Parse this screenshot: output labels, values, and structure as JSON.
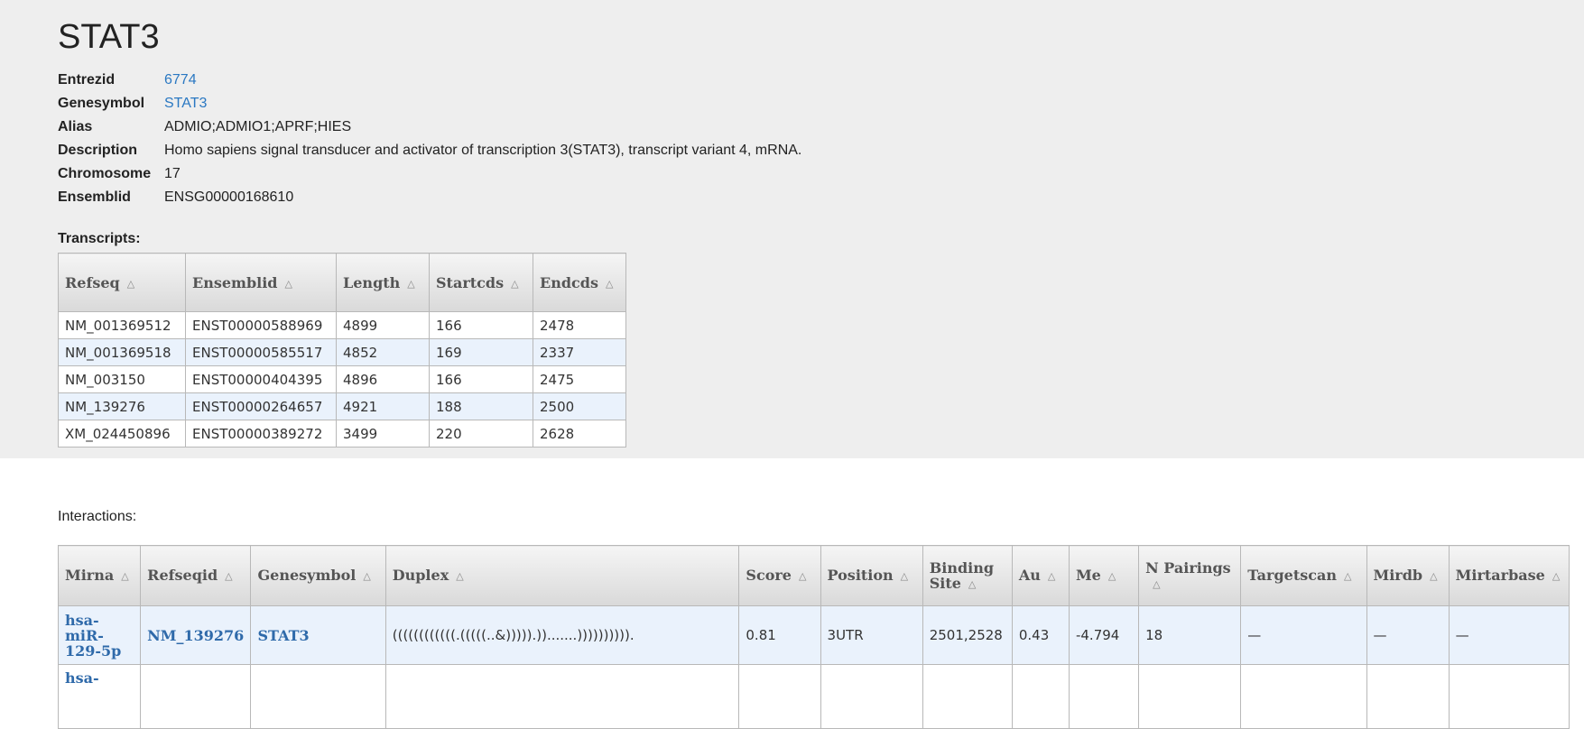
{
  "gene": {
    "title": "STAT3",
    "fields": [
      {
        "label": "Entrezid",
        "value": "6774",
        "link": true
      },
      {
        "label": "Genesymbol",
        "value": "STAT3",
        "link": true
      },
      {
        "label": "Alias",
        "value": "ADMIO;ADMIO1;APRF;HIES",
        "link": false
      },
      {
        "label": "Description",
        "value": "Homo sapiens signal transducer and activator of transcription 3(STAT3), transcript variant 4, mRNA.",
        "link": false
      },
      {
        "label": "Chromosome",
        "value": "17",
        "link": false
      },
      {
        "label": "Ensemblid",
        "value": "ENSG00000168610",
        "link": false
      }
    ]
  },
  "transcripts": {
    "title": "Transcripts:",
    "columns": [
      "Refseq",
      "Ensemblid",
      "Length",
      "Startcds",
      "Endcds"
    ],
    "rows": [
      [
        "NM_001369512",
        "ENST00000588969",
        "4899",
        "166",
        "2478"
      ],
      [
        "NM_001369518",
        "ENST00000585517",
        "4852",
        "169",
        "2337"
      ],
      [
        "NM_003150",
        "ENST00000404395",
        "4896",
        "166",
        "2475"
      ],
      [
        "NM_139276",
        "ENST00000264657",
        "4921",
        "188",
        "2500"
      ],
      [
        "XM_024450896",
        "ENST00000389272",
        "3499",
        "220",
        "2628"
      ]
    ]
  },
  "interactions": {
    "title": "Interactions:",
    "columns": [
      "Mirna",
      "Refseqid",
      "Genesymbol",
      "Duplex",
      "Score",
      "Position",
      "Binding Site",
      "Au",
      "Me",
      "N Pairings",
      "Targetscan",
      "Mirdb",
      "Mirtarbase"
    ],
    "rows": [
      [
        "hsa-miR-129-5p",
        "NM_139276",
        "STAT3",
        "((((((((((((.(((((..&))))).)).......)))))))))).",
        "0.81",
        "3UTR",
        "2501,2528",
        "0.43",
        "-4.794",
        "18",
        "—",
        "—",
        "—"
      ],
      [
        "hsa-",
        "",
        "",
        "",
        "",
        "",
        "",
        "",
        "",
        "",
        "",
        "",
        ""
      ]
    ]
  },
  "icons": {
    "sort": "sort-caret-icon"
  },
  "colors": {
    "link": "#2a78c2",
    "row_alt": "#eaf2fc",
    "top_bg": "#eeeeee"
  }
}
